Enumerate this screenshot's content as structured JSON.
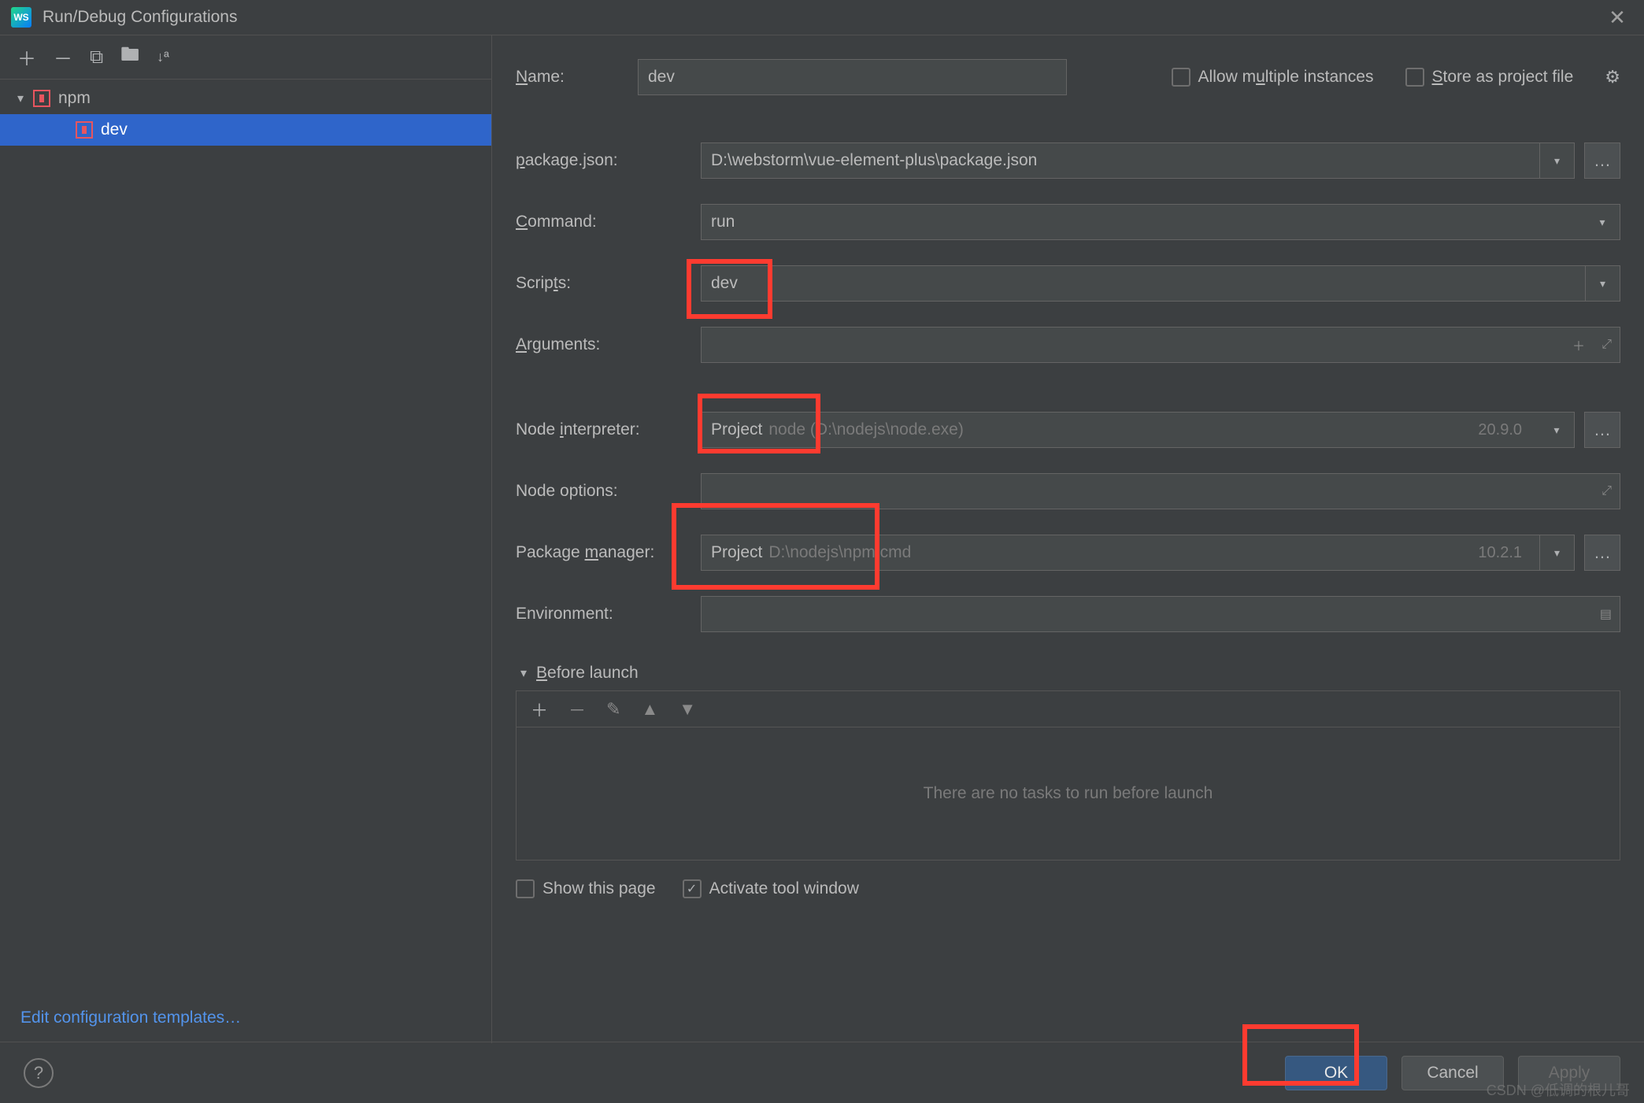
{
  "titlebar": {
    "app": "WS",
    "title": "Run/Debug Configurations"
  },
  "sidebar": {
    "items": [
      {
        "label": "npm"
      },
      {
        "label": "dev"
      }
    ],
    "footer_link": "Edit configuration templates…"
  },
  "top": {
    "name_label": "Name:",
    "name_value": "dev",
    "allow_multiple": "Allow multiple instances",
    "store_project": "Store as project file"
  },
  "form": {
    "package_label": "package.json:",
    "package_value": "D:\\webstorm\\vue-element-plus\\package.json",
    "command_label": "Command:",
    "command_value": "run",
    "scripts_label": "Scripts:",
    "scripts_value": "dev",
    "arguments_label": "Arguments:",
    "arguments_value": "",
    "node_interp_label": "Node interpreter:",
    "node_interp_prefix": "Project",
    "node_interp_hint": "node (D:\\nodejs\\node.exe)",
    "node_interp_version": "20.9.0",
    "node_options_label": "Node options:",
    "node_options_value": "",
    "pkg_mgr_label": "Package manager:",
    "pkg_mgr_prefix": "Project",
    "pkg_mgr_hint": "D:\\nodejs\\npm.cmd",
    "pkg_mgr_version": "10.2.1",
    "env_label": "Environment:",
    "env_value": ""
  },
  "before": {
    "header": "Before launch",
    "empty": "There are no tasks to run before launch",
    "show_page": "Show this page",
    "activate_tool": "Activate tool window"
  },
  "footer": {
    "ok": "OK",
    "cancel": "Cancel",
    "apply": "Apply"
  },
  "watermark": "CSDN @低调的根儿哥"
}
